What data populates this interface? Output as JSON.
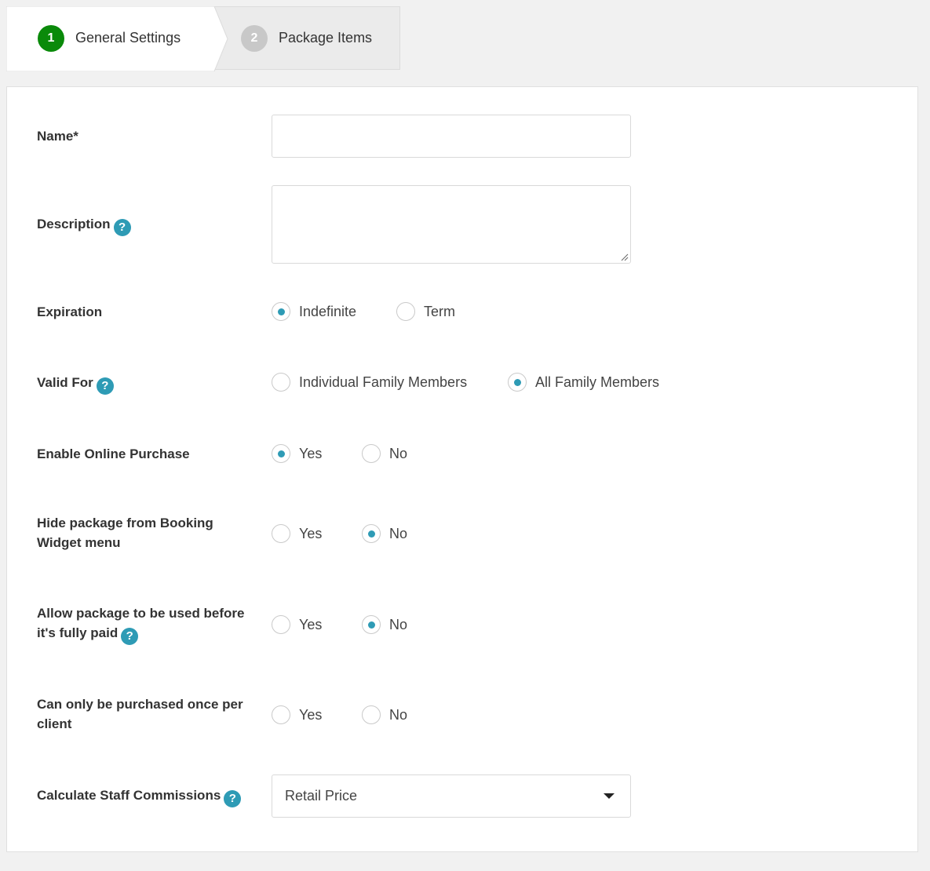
{
  "stepper": {
    "steps": [
      {
        "number": "1",
        "label": "General Settings"
      },
      {
        "number": "2",
        "label": "Package Items"
      }
    ]
  },
  "form": {
    "name": {
      "label": "Name*",
      "value": ""
    },
    "description": {
      "label": "Description",
      "value": ""
    },
    "expiration": {
      "label": "Expiration",
      "options": [
        "Indefinite",
        "Term"
      ],
      "selected": "Indefinite"
    },
    "valid_for": {
      "label": "Valid For",
      "options": [
        "Individual Family Members",
        "All Family Members"
      ],
      "selected": "All Family Members"
    },
    "online_purchase": {
      "label": "Enable Online Purchase",
      "options": [
        "Yes",
        "No"
      ],
      "selected": "Yes"
    },
    "hide_package": {
      "label": "Hide package from Booking Widget menu",
      "options": [
        "Yes",
        "No"
      ],
      "selected": "No"
    },
    "allow_before_paid": {
      "label": "Allow package to be used before it's fully paid",
      "options": [
        "Yes",
        "No"
      ],
      "selected": "No"
    },
    "purchase_once": {
      "label": "Can only be purchased once per client",
      "options": [
        "Yes",
        "No"
      ],
      "selected": ""
    },
    "staff_commissions": {
      "label": "Calculate Staff Commissions",
      "value": "Retail Price"
    }
  },
  "icons": {
    "help": "question-circle-icon",
    "dropdown": "caret-down-icon"
  },
  "colors": {
    "accent": "#2e9bb5",
    "step_active": "#0a8a0a",
    "step_inactive": "#c8c8c8"
  }
}
